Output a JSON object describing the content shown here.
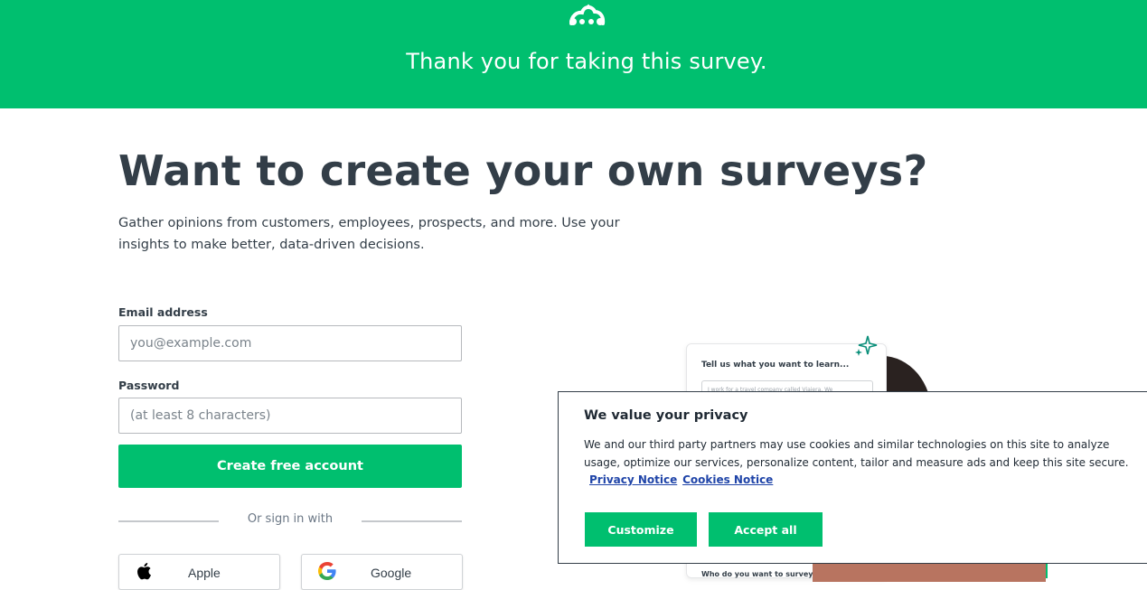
{
  "header": {
    "title": "Thank you for taking this survey."
  },
  "hero": {
    "title": "Want to create your own surveys?",
    "subtitle": "Gather opinions from customers, employees, prospects, and more. Use your insights to make better, data-driven decisions."
  },
  "form": {
    "email_label": "Email address",
    "email_placeholder": "you@example.com",
    "email_value": "",
    "password_label": "Password",
    "password_placeholder": "(at least 8 characters)",
    "password_value": "",
    "submit_label": "Create free account",
    "divider_text": "Or sign in with",
    "sso": [
      {
        "label": "Apple",
        "icon": "apple-icon"
      },
      {
        "label": "Google",
        "icon": "google-icon"
      }
    ]
  },
  "illustration": {
    "question": "Tell us what you want to learn...",
    "input_text": "I work for a travel company called Viajera. We",
    "question2": "Who do you want to survey?"
  },
  "cookie_banner": {
    "title": "We value your privacy",
    "text": "We and our third party partners may use cookies and similar technologies on this site to analyze usage, optimize our services, personalize content, tailor and measure ads and keep this site secure.",
    "privacy_link": "Privacy Notice",
    "cookies_link": "Cookies Notice",
    "customize_label": "Customize",
    "accept_label": "Accept all"
  },
  "colors": {
    "brand_green": "#00bf6f",
    "text_dark": "#333e48",
    "link_blue": "#1f44a8"
  }
}
